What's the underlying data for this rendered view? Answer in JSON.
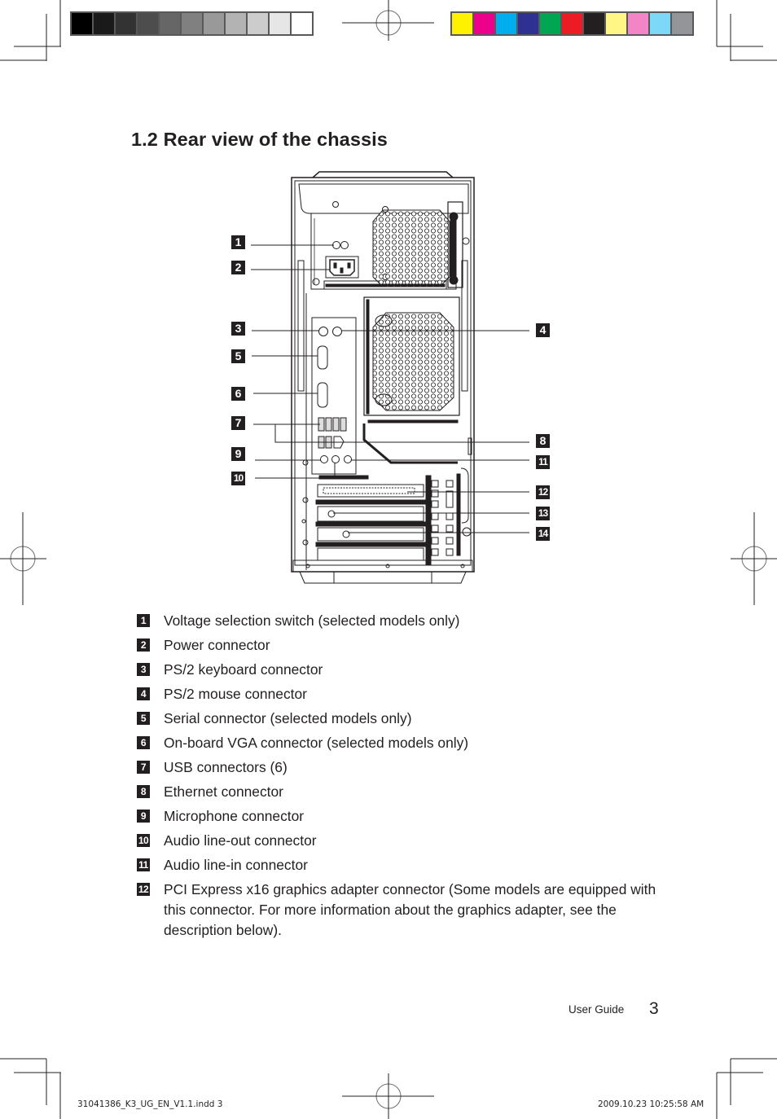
{
  "print_marks": {
    "grayscale_swatches": [
      "#000000",
      "#1a1a1a",
      "#333333",
      "#4d4d4d",
      "#666666",
      "#808080",
      "#999999",
      "#b3b3b3",
      "#cccccc",
      "#e6e6e6",
      "#ffffff"
    ],
    "color_swatches": [
      "#fff200",
      "#ec008c",
      "#00aeef",
      "#2e3192",
      "#00a651",
      "#ed1c24",
      "#231f20",
      "#fff685",
      "#f384c5",
      "#7dd8f7",
      "#939598"
    ]
  },
  "section": {
    "title": "1.2 Rear view of the chassis"
  },
  "diagram": {
    "callouts_left": [
      "1",
      "2",
      "3",
      "5",
      "6",
      "7",
      "9",
      "10"
    ],
    "callouts_right": [
      "4",
      "8",
      "11",
      "12",
      "13",
      "14"
    ]
  },
  "legend": [
    {
      "num": "1",
      "text": "Voltage selection switch (selected models only)"
    },
    {
      "num": "2",
      "text": "Power connector"
    },
    {
      "num": "3",
      "text": "PS/2 keyboard connector"
    },
    {
      "num": "4",
      "text": "PS/2 mouse connector"
    },
    {
      "num": "5",
      "text": "Serial connector (selected models only)"
    },
    {
      "num": "6",
      "text": "On-board VGA connector (selected models only)"
    },
    {
      "num": "7",
      "text": "USB connectors (6)"
    },
    {
      "num": "8",
      "text": "Ethernet connector"
    },
    {
      "num": "9",
      "text": "Microphone connector"
    },
    {
      "num": "10",
      "text": "Audio line-out connector"
    },
    {
      "num": "11",
      "text": "Audio line-in connector"
    },
    {
      "num": "12",
      "text": "PCI Express x16 graphics adapter connector (Some models are equipped with this connector. For more information about the graphics adapter, see the description below)."
    }
  ],
  "footer": {
    "guide_label": "User Guide",
    "page_number": "3"
  },
  "slug": {
    "file": "31041386_K3_UG_EN_V1.1.indd   3",
    "timestamp": "2009.10.23    10:25:58  AM"
  }
}
